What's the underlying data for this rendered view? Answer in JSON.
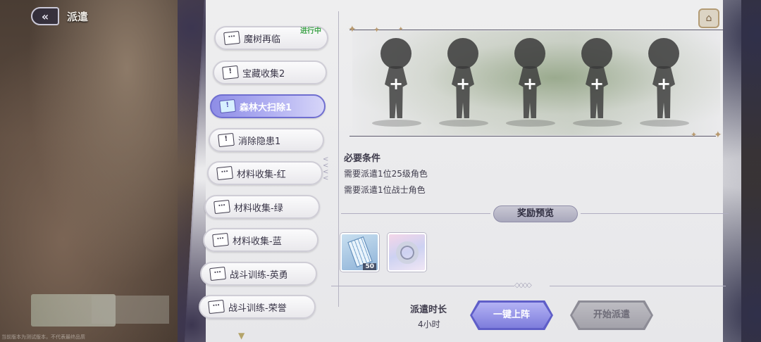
{
  "header": {
    "back_icon": "back-arrow-icon",
    "title": "派遣"
  },
  "missions": [
    {
      "label": "魔树再临",
      "status": "进行中"
    },
    {
      "label": "宝藏收集2",
      "status": ""
    },
    {
      "label": "森林大扫除1",
      "status": ""
    },
    {
      "label": "消除隐患1",
      "status": ""
    },
    {
      "label": "材料收集-红",
      "status": ""
    },
    {
      "label": "材料收集-绿",
      "status": ""
    },
    {
      "label": "材料收集-蓝",
      "status": ""
    },
    {
      "label": "战斗训练-英勇",
      "status": ""
    },
    {
      "label": "战斗训练-荣誉",
      "status": ""
    }
  ],
  "selected_mission_index": 2,
  "slots": [
    "+",
    "+",
    "+",
    "+",
    "+"
  ],
  "requirements": {
    "title": "必要条件",
    "items": [
      "需要派遣1位25级角色",
      "需要派遣1位战士角色"
    ]
  },
  "rewards": {
    "title": "奖励预览",
    "items": [
      {
        "name": "tickets-icon",
        "qty": "50"
      },
      {
        "name": "ring-icon",
        "qty": ""
      }
    ]
  },
  "duration": {
    "label": "派遣时长",
    "value": "4小时"
  },
  "buttons": {
    "auto_fill": "一键上阵",
    "start": "开始派遣"
  },
  "footer_note": "当前版本为测试版本，不代表最终品质",
  "colors": {
    "accent": "#8e8de6",
    "in_progress": "#3fa34a",
    "panel": "#eeeeef"
  }
}
